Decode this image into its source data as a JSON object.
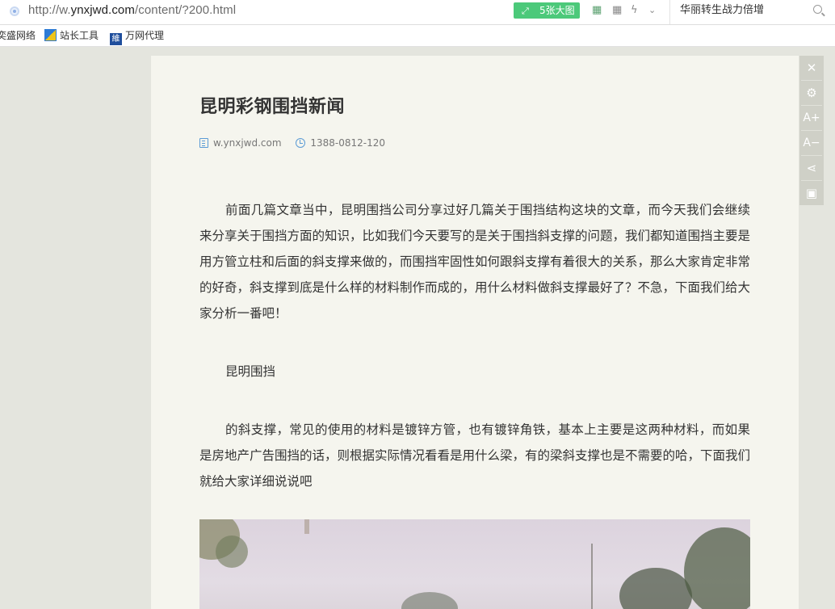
{
  "browser": {
    "url_prefix": "http://w.",
    "url_domain": "ynxjwd.com",
    "url_path": "/content/?200.html",
    "bigimg_label": "5张大图",
    "search_text": "华丽转生战力倍增"
  },
  "bookmarks": [
    {
      "label": "奕盛网络"
    },
    {
      "label": "站长工具"
    },
    {
      "label": "万网代理"
    }
  ],
  "article": {
    "title": "昆明彩钢围挡新闻",
    "site": "w.ynxjwd.com",
    "phone": "1388-0812-120",
    "paragraphs": [
      "前面几篇文章当中，昆明围挡公司分享过好几篇关于围挡结构这块的文章，而今天我们会继续来分享关于围挡方面的知识，比如我们今天要写的是关于围挡斜支撑的问题，我们都知道围挡主要是用方管立柱和后面的斜支撑来做的，而围挡牢固性如何跟斜支撑有着很大的关系，那么大家肯定非常的好奇，斜支撑到底是什么样的材料制作而成的，用什么材料做斜支撑最好了？不急，下面我们给大家分析一番吧！",
      "昆明围挡",
      "的斜支撑，常见的使用的材料是镀锌方管，也有镀锌角铁，基本上主要是这两种材料，而如果是房地产广告围挡的话，则根据实际情况看看是用什么梁，有的梁斜支撑也是不需要的哈，下面我们就给大家详细说说吧"
    ]
  },
  "toolbar": {
    "close_glyph": "✕",
    "settings_glyph": "⚙",
    "font_up_label": "A+",
    "font_down_label": "A−",
    "share_glyph": "⋖",
    "save_glyph": "▣"
  }
}
